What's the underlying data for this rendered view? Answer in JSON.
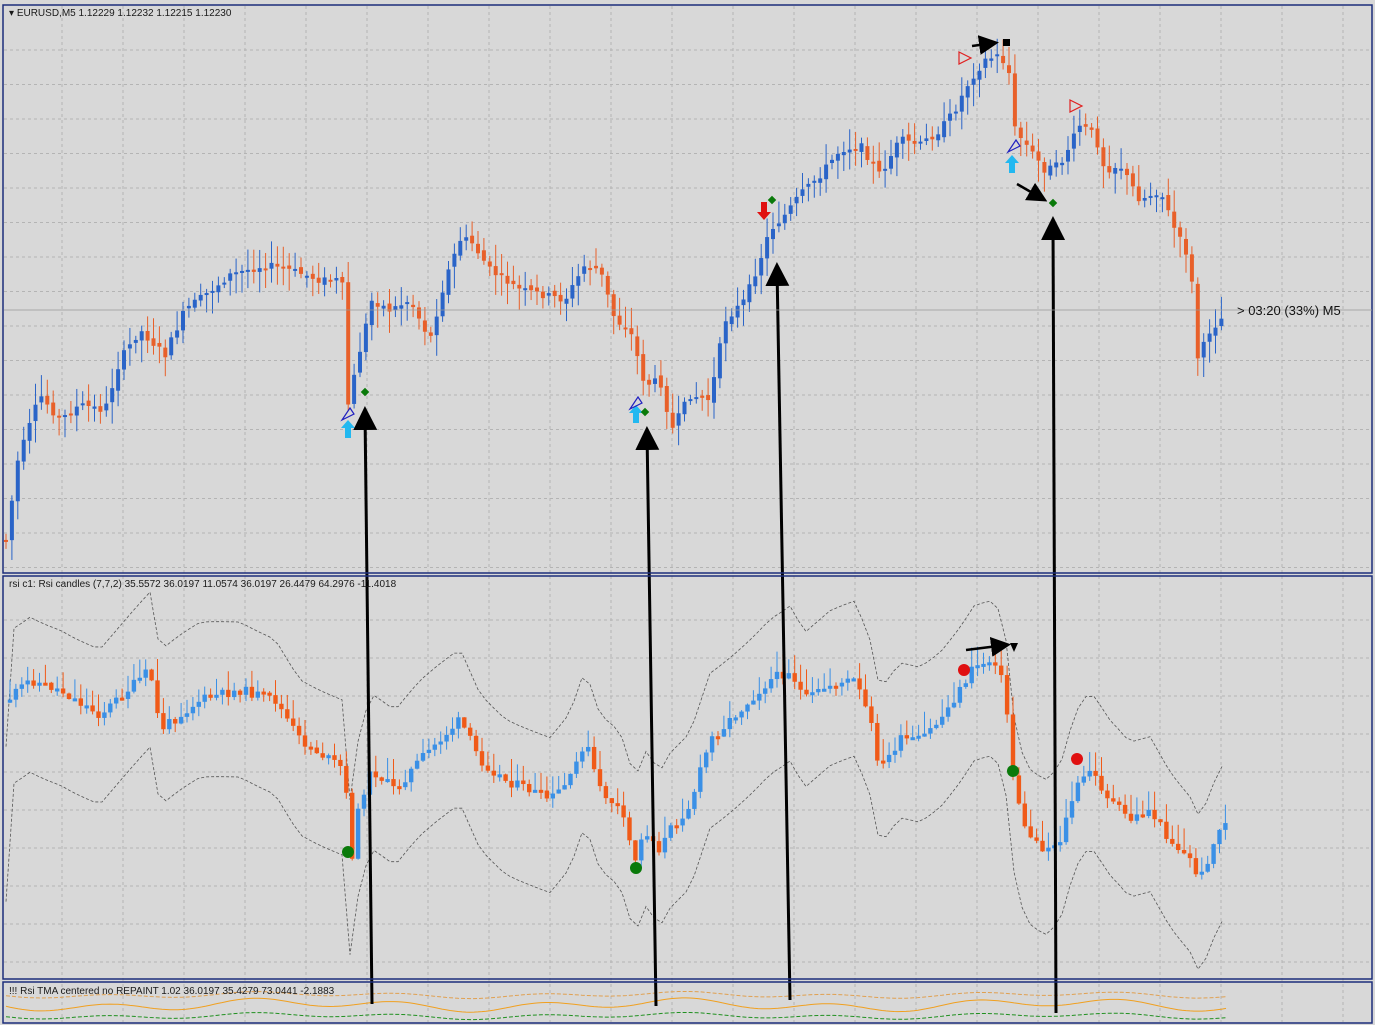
{
  "panes": {
    "main": {
      "title": "EURUSD,M5  1.12229 1.12232 1.12215 1.12230"
    },
    "rsi": {
      "title": "rsi c1: Rsi candles (7,7,2) 35.5572 36.0197 11.0574 36.0197 26.4479 64.2976 -11.4018"
    },
    "tma": {
      "title": "!!! Rsi TMA centered no REPAINT 1.02 36.0197 35.4279 73.0441 -2.1883"
    }
  },
  "price_tag": "> 03:20 (33%) M5",
  "colors": {
    "background": "#d8d8d8",
    "grid": "#b4b4b4",
    "border": "#1c2d7a",
    "bull": "#2a64c8",
    "bear": "#e8602a",
    "rsi_bull": "#3a90e6",
    "rsi_bear": "#f05a18",
    "tma_line": "#f0a020",
    "tma_upper": "#e0a050",
    "tma_lower": "#209020",
    "arrow": "#000000",
    "buy_arrow": "#22b8f0",
    "sell_arrow": "#e01010",
    "green_dot": "#0a7a0a",
    "red_dot": "#e01010"
  },
  "chart_data": {
    "type": "candlestick",
    "symbol": "EURUSD",
    "timeframe": "M5",
    "last_ohlc": {
      "open": 1.12229,
      "high": 1.12232,
      "low": 1.12215,
      "close": 1.1223
    },
    "indicators": [
      {
        "name": "Rsi candles",
        "params": "(7,7,2)",
        "values": [
          35.5572,
          36.0197,
          11.0574,
          36.0197,
          26.4479,
          64.2976,
          -11.4018
        ]
      },
      {
        "name": "Rsi TMA centered no REPAINT",
        "params": "1.02",
        "values": [
          36.0197,
          35.4279,
          73.0441,
          -2.1883
        ]
      }
    ],
    "signals": {
      "buy_arrows": 3,
      "sell_arrows": 1,
      "rsi_green_dots": 3,
      "rsi_red_dots": 2
    }
  }
}
